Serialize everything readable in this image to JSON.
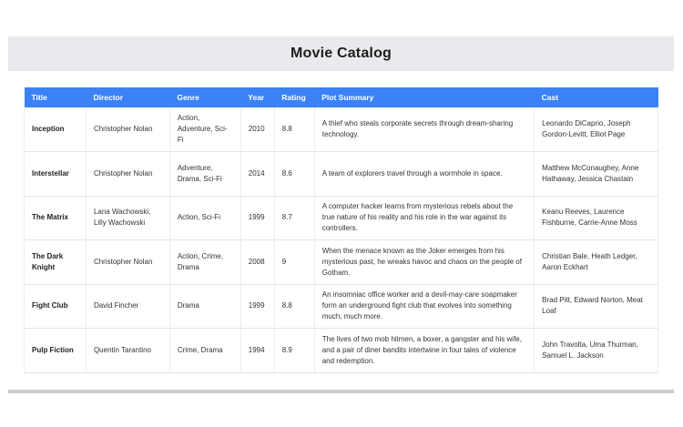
{
  "page_title": "Movie Catalog",
  "columns": [
    "Title",
    "Director",
    "Genre",
    "Year",
    "Rating",
    "Plot Summary",
    "Cast"
  ],
  "rows": [
    {
      "title": "Inception",
      "director": "Christopher Nolan",
      "genre": "Action, Adventure, Sci-Fi",
      "year": "2010",
      "rating": "8.8",
      "plot": "A thief who steals corporate secrets through dream-sharing technology.",
      "cast": "Leonardo DiCaprio, Joseph Gordon-Levitt, Elliot Page"
    },
    {
      "title": "Interstellar",
      "director": "Christopher Nolan",
      "genre": "Adventure, Drama, Sci-Fi",
      "year": "2014",
      "rating": "8.6",
      "plot": "A team of explorers travel through a wormhole in space.",
      "cast": "Matthew McConaughey, Anne Hathaway, Jessica Chastain"
    },
    {
      "title": "The Matrix",
      "director": "Lana Wachowski, Lilly Wachowski",
      "genre": "Action, Sci-Fi",
      "year": "1999",
      "rating": "8.7",
      "plot": "A computer hacker learns from mysterious rebels about the true nature of his reality and his role in the war against its controllers.",
      "cast": "Keanu Reeves, Laurence Fishburne, Carrie-Anne Moss"
    },
    {
      "title": "The Dark Knight",
      "director": "Christopher Nolan",
      "genre": "Action, Crime, Drama",
      "year": "2008",
      "rating": "9",
      "plot": "When the menace known as the Joker emerges from his mysterious past, he wreaks havoc and chaos on the people of Gotham.",
      "cast": "Christian Bale, Heath Ledger, Aaron Eckhart"
    },
    {
      "title": "Fight Club",
      "director": "David Fincher",
      "genre": "Drama",
      "year": "1999",
      "rating": "8.8",
      "plot": "An insomniac office worker and a devil-may-care soapmaker form an underground fight club that evolves into something much, much more.",
      "cast": "Brad Pitt, Edward Norton, Meat Loaf"
    },
    {
      "title": "Pulp Fiction",
      "director": "Quentin Tarantino",
      "genre": "Crime, Drama",
      "year": "1994",
      "rating": "8.9",
      "plot": "The lives of two mob hitmen, a boxer, a gangster and his wife, and a pair of diner bandits intertwine in four tales of violence and redemption.",
      "cast": "John Travolta, Uma Thurman, Samuel L. Jackson"
    }
  ],
  "colors": {
    "header_bg": "#e9eaed",
    "table_header_bg": "#3b82f6"
  }
}
